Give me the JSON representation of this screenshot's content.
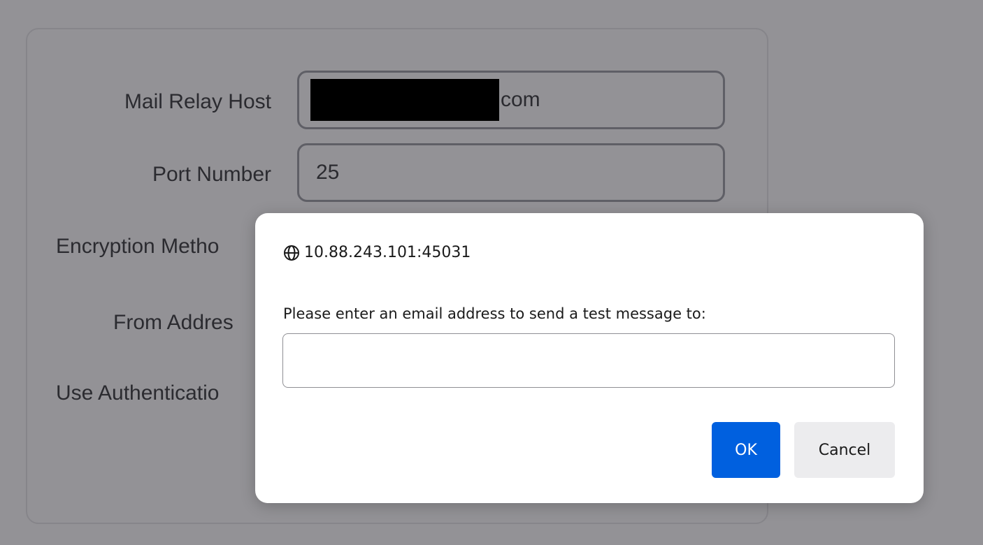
{
  "background_form": {
    "fields": [
      {
        "label": "Mail Relay Host",
        "value_suffix": "com",
        "value_redacted": true
      },
      {
        "label": "Port Number",
        "value": "25"
      },
      {
        "label": "Encryption Metho"
      },
      {
        "label": "From Addres"
      },
      {
        "label": "Use Authenticatio"
      }
    ]
  },
  "dialog": {
    "origin": "10.88.243.101:45031",
    "origin_icon": "globe-icon",
    "message": "Please enter an email address to send a test message to:",
    "input_value": "",
    "ok_label": "OK",
    "cancel_label": "Cancel"
  },
  "colors": {
    "overlay_background": "#939296",
    "dialog_background": "#ffffff",
    "ok_button": "#0060df",
    "cancel_button": "#ececee"
  }
}
